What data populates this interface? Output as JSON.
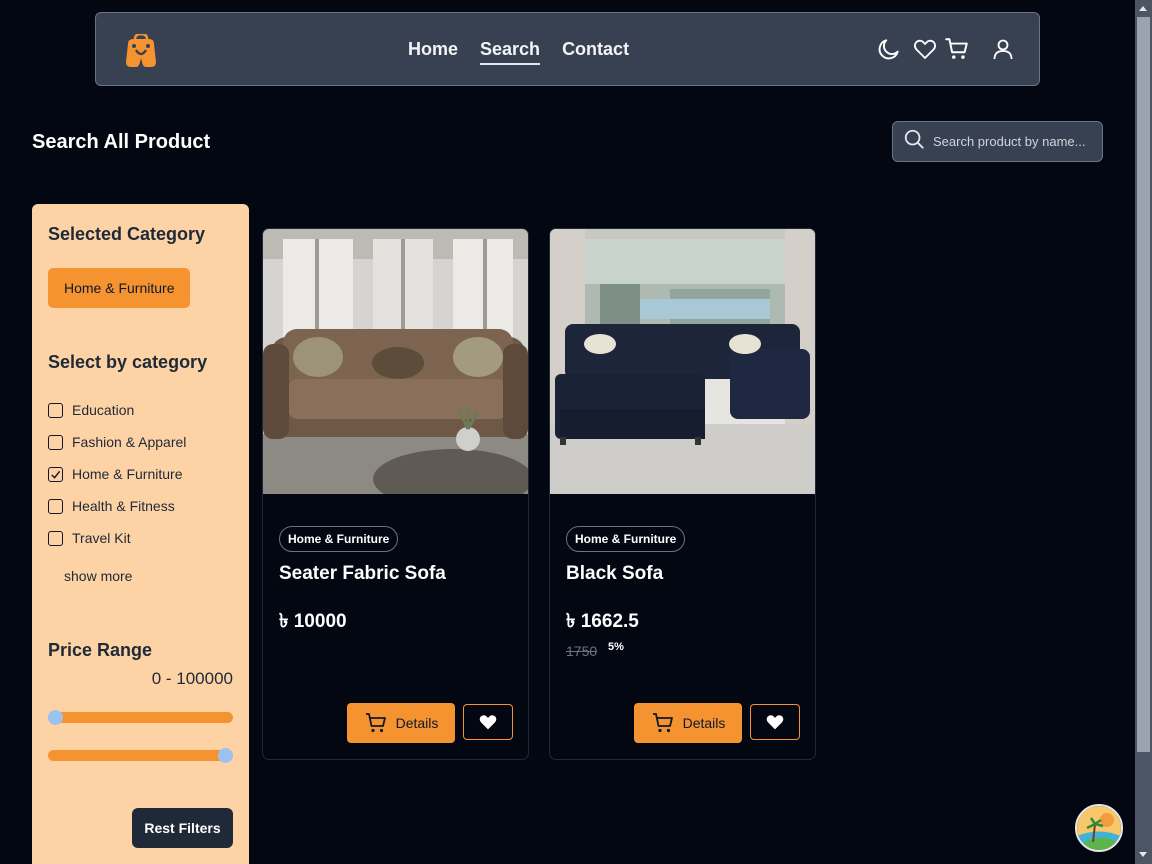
{
  "nav": {
    "links": [
      "Home",
      "Search",
      "Contact"
    ],
    "active": "Search",
    "icons": [
      "moon-icon",
      "heart-icon",
      "cart-icon",
      "user-icon"
    ]
  },
  "page": {
    "title": "Search All Product",
    "search_placeholder": "Search product by name..."
  },
  "sidebar": {
    "selected_heading": "Selected Category",
    "selected_chip": "Home & Furniture",
    "category_heading": "Select by category",
    "categories": [
      {
        "label": "Education",
        "checked": false
      },
      {
        "label": "Fashion & Apparel",
        "checked": false
      },
      {
        "label": "Home & Furniture",
        "checked": true
      },
      {
        "label": "Health & Fitness",
        "checked": false
      },
      {
        "label": "Travel Kit",
        "checked": false
      }
    ],
    "show_more": "show more",
    "price_heading": "Price Range",
    "price_value": "0 - 100000",
    "reset_label": "Rest Filters"
  },
  "products": [
    {
      "category": "Home & Furniture",
      "title": "Seater Fabric Sofa",
      "price": "৳ 10000",
      "old_price": "",
      "discount": "",
      "details_label": "Details"
    },
    {
      "category": "Home & Furniture",
      "title": "Black Sofa",
      "price": "৳ 1662.5",
      "old_price": "1750",
      "discount": "5%",
      "details_label": "Details"
    }
  ],
  "colors": {
    "accent": "#f59331",
    "sidebar_bg": "#fdd3a6",
    "page_bg": "#030712",
    "navbar_bg": "#374151"
  }
}
